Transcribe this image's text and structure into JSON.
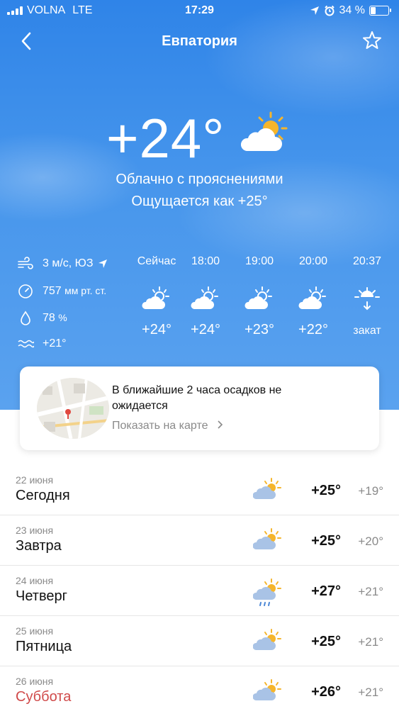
{
  "status_bar": {
    "carrier": "VOLNA",
    "network": "LTE",
    "time": "17:29",
    "battery": "34 %",
    "battery_level": 0.34
  },
  "header": {
    "title": "Евпатория"
  },
  "current": {
    "temperature": "+24°",
    "condition": "Облачно с прояснениями",
    "feels_like": "Ощущается как +25°",
    "icon": "partly-cloudy-icon"
  },
  "details": {
    "wind": "3 м/с, ЮЗ",
    "pressure_value": "757",
    "pressure_unit": "мм рт. ст.",
    "humidity_value": "78",
    "humidity_unit": "%",
    "water_temp": "+21°"
  },
  "hourly": [
    {
      "label": "Сейчас",
      "temp": "+24°",
      "icon": "partly-cloudy-icon"
    },
    {
      "label": "18:00",
      "temp": "+24°",
      "icon": "partly-cloudy-icon"
    },
    {
      "label": "19:00",
      "temp": "+23°",
      "icon": "partly-cloudy-icon"
    },
    {
      "label": "20:00",
      "temp": "+22°",
      "icon": "partly-cloudy-icon"
    },
    {
      "label": "20:37",
      "temp": "закат",
      "icon": "sunset-icon"
    }
  ],
  "precip_card": {
    "text": "В ближайшие 2 часа осадков не ожидается",
    "link": "Показать на карте"
  },
  "daily": [
    {
      "date": "22 июня",
      "name": "Сегодня",
      "hi": "+25°",
      "lo": "+19°",
      "icon": "partly-cloudy-icon",
      "weekend": false
    },
    {
      "date": "23 июня",
      "name": "Завтра",
      "hi": "+25°",
      "lo": "+20°",
      "icon": "partly-cloudy-icon",
      "weekend": false
    },
    {
      "date": "24 июня",
      "name": "Четверг",
      "hi": "+27°",
      "lo": "+21°",
      "icon": "rain-sun-icon",
      "weekend": false
    },
    {
      "date": "25 июня",
      "name": "Пятница",
      "hi": "+25°",
      "lo": "+21°",
      "icon": "partly-cloudy-icon",
      "weekend": false
    },
    {
      "date": "26 июня",
      "name": "Суббота",
      "hi": "+26°",
      "lo": "+21°",
      "icon": "partly-cloudy-icon",
      "weekend": true
    }
  ],
  "colors": {
    "sky_top": "#2f84e8",
    "sky_bottom": "#5aa2ef",
    "sun": "#f5b52c",
    "weekend": "#d04a4a"
  }
}
